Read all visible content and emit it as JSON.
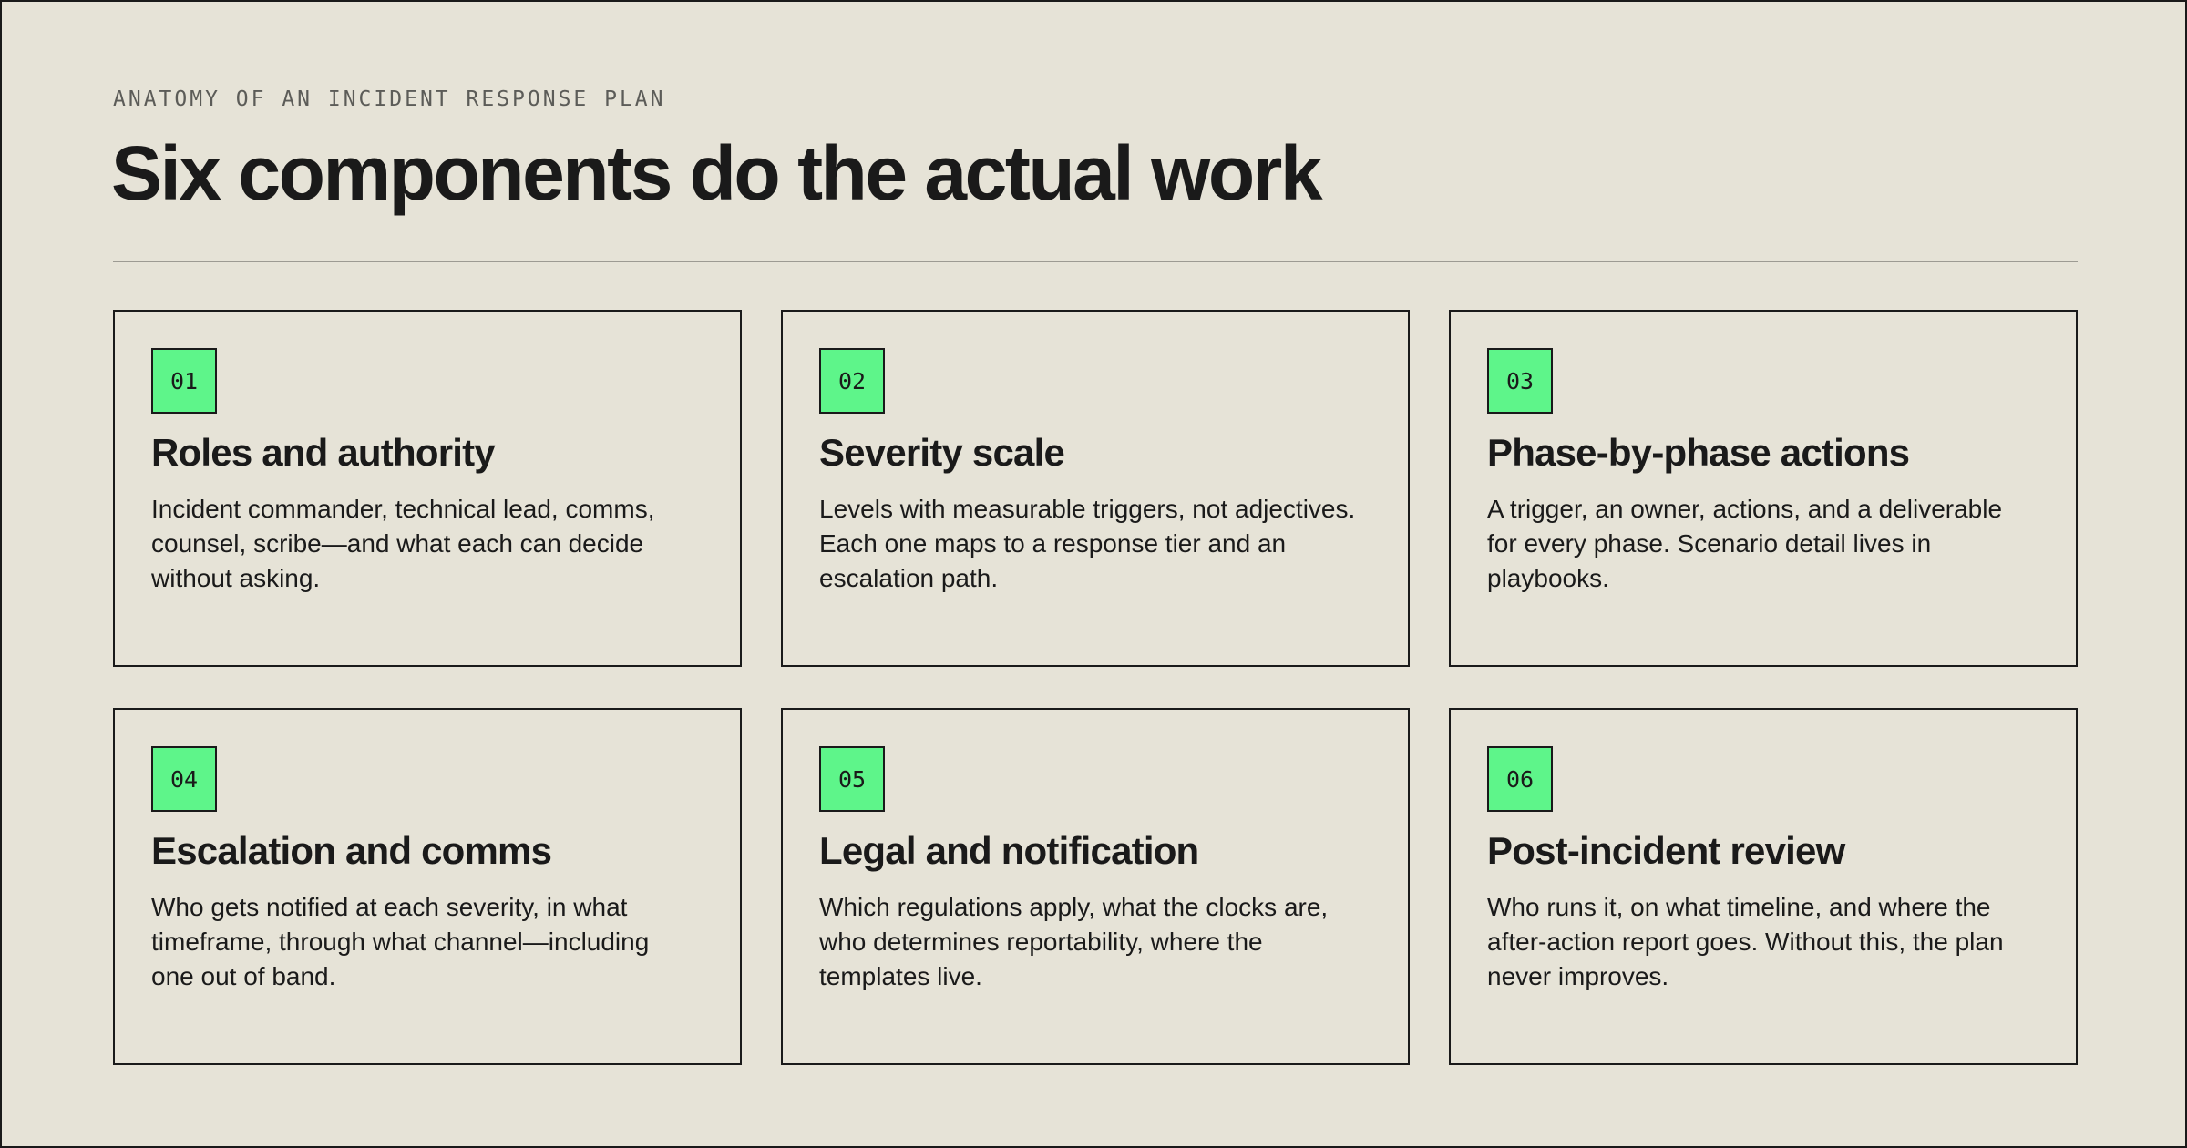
{
  "header": {
    "eyebrow": "ANATOMY OF AN INCIDENT RESPONSE PLAN",
    "title": "Six components do the actual work"
  },
  "colors": {
    "background": "#e6e3d7",
    "ink": "#1a1a1a",
    "accent": "#5ef58a",
    "muted": "#5c5c58"
  },
  "components": [
    {
      "number": "01",
      "title": "Roles and authority",
      "description": "Incident commander, technical lead, comms, counsel, scribe—and what each can decide without asking."
    },
    {
      "number": "02",
      "title": "Severity scale",
      "description": "Levels with measurable triggers, not adjectives. Each one maps to a response tier and an escalation path."
    },
    {
      "number": "03",
      "title": "Phase-by-phase actions",
      "description": "A trigger, an owner, actions, and a deliverable for every phase. Scenario detail lives in playbooks."
    },
    {
      "number": "04",
      "title": "Escalation and comms",
      "description": "Who gets notified at each severity, in what timeframe, through what channel—including one out of band."
    },
    {
      "number": "05",
      "title": "Legal and notification",
      "description": "Which regulations apply, what the clocks are, who determines reportability, where the templates live."
    },
    {
      "number": "06",
      "title": "Post-incident review",
      "description": "Who runs it, on what timeline, and where the after-action report goes. Without this, the plan never improves."
    }
  ]
}
